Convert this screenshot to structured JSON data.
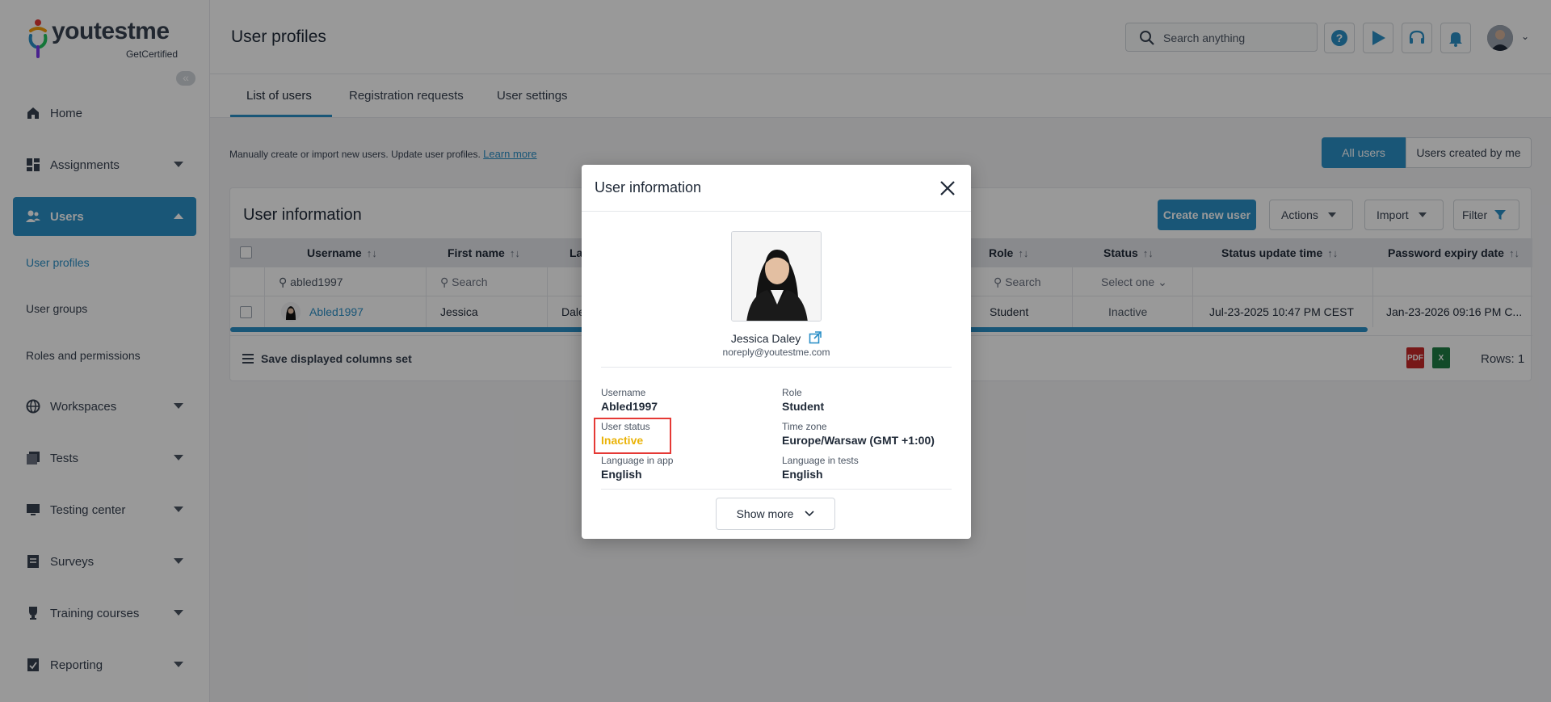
{
  "brand": {
    "logo_text": "youtestme",
    "logo_sub": "GetCertified",
    "accent": "#2b8fc7"
  },
  "sidebar": {
    "items": [
      {
        "label": "Home",
        "icon": "home-icon"
      },
      {
        "label": "Assignments",
        "icon": "assignments-icon"
      },
      {
        "label": "Users",
        "icon": "users-icon",
        "active": true
      },
      {
        "label": "Workspaces",
        "icon": "globe-icon"
      },
      {
        "label": "Tests",
        "icon": "tests-icon"
      },
      {
        "label": "Testing center",
        "icon": "monitor-icon"
      },
      {
        "label": "Surveys",
        "icon": "survey-icon"
      },
      {
        "label": "Training courses",
        "icon": "trophy-icon"
      },
      {
        "label": "Reporting",
        "icon": "report-icon"
      }
    ],
    "users_sub": [
      "User profiles",
      "User groups",
      "Roles and permissions"
    ]
  },
  "header": {
    "title": "User profiles",
    "search_placeholder": "Search anything"
  },
  "tabs": [
    "List of users",
    "Registration requests",
    "User settings"
  ],
  "content": {
    "description": "Manually create or import new users. Update user profiles.",
    "learn_more": "Learn more",
    "view_all": "All users",
    "view_mine": "Users created by me"
  },
  "table": {
    "title": "User information",
    "create_button": "Create new user",
    "actions_button": "Actions",
    "import_button": "Import",
    "filter_button": "Filter",
    "columns": [
      "Username",
      "First name",
      "La",
      "Role",
      "Status",
      "Status update time",
      "Password expiry date"
    ],
    "filters": {
      "username": "abled1997",
      "first_name": "Search",
      "role": "Search",
      "status": "Select one"
    },
    "row": {
      "username": "Abled1997",
      "first_name": "Jessica",
      "last_name_partial": "Dale",
      "role": "Student",
      "status": "Inactive",
      "status_update_time": "Jul-23-2025 10:47 PM CEST",
      "password_expiry": "Jan-23-2026 09:16 PM C..."
    },
    "save_columns": "Save displayed columns set",
    "rows_label": "Rows: 1"
  },
  "modal": {
    "title": "User information",
    "full_name": "Jessica Daley",
    "email": "noreply@youtestme.com",
    "fields": {
      "username_label": "Username",
      "username_value": "Abled1997",
      "role_label": "Role",
      "role_value": "Student",
      "status_label": "User status",
      "status_value": "Inactive",
      "timezone_label": "Time zone",
      "timezone_value": "Europe/Warsaw (GMT +1:00)",
      "lang_app_label": "Language in app",
      "lang_app_value": "English",
      "lang_tests_label": "Language in tests",
      "lang_tests_value": "English"
    },
    "show_more": "Show more"
  }
}
